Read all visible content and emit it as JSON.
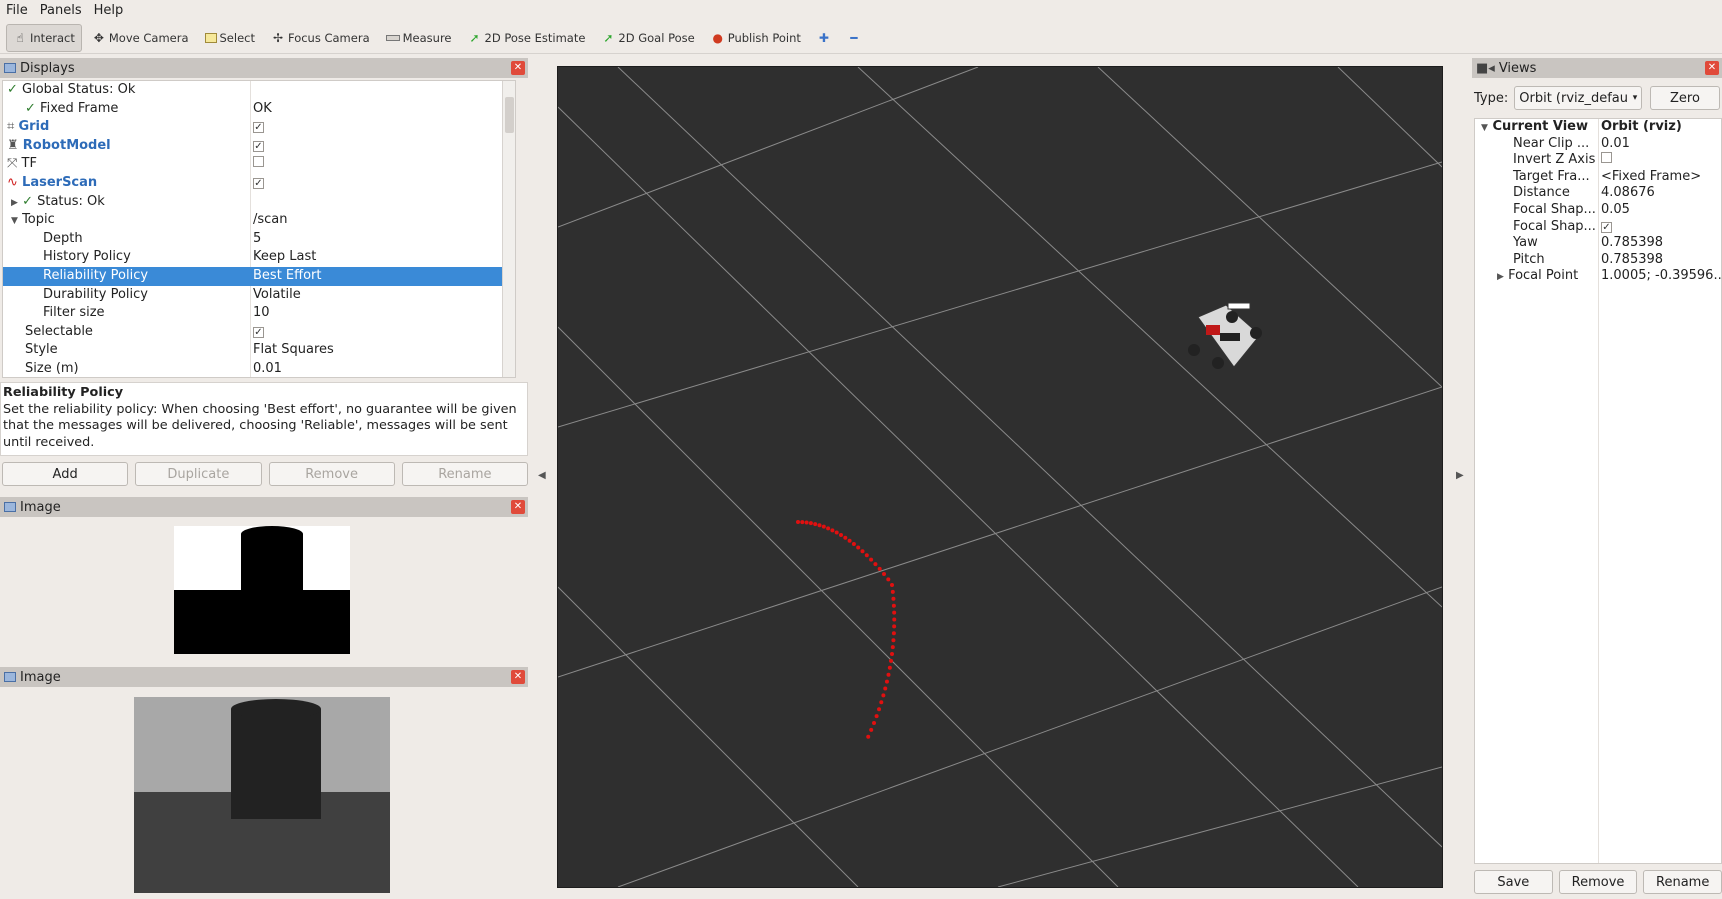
{
  "menu": [
    "File",
    "Panels",
    "Help"
  ],
  "toolbar": {
    "tools": [
      {
        "label": "Interact",
        "icon": "hand-icon"
      },
      {
        "label": "Move Camera",
        "icon": "move-icon"
      },
      {
        "label": "Select",
        "icon": "select-box-icon"
      },
      {
        "label": "Focus Camera",
        "icon": "focus-icon"
      },
      {
        "label": "Measure",
        "icon": "ruler-icon"
      },
      {
        "label": "2D Pose Estimate",
        "icon": "arrow-green-icon"
      },
      {
        "label": "2D Goal Pose",
        "icon": "arrow-green-icon"
      },
      {
        "label": "Publish Point",
        "icon": "pin-icon"
      }
    ]
  },
  "displays": {
    "title": "Displays",
    "rows": [
      {
        "key": "Global Status: Ok",
        "value": ""
      },
      {
        "key": "Fixed Frame",
        "value": "OK"
      },
      {
        "key": "Grid",
        "value": ""
      },
      {
        "key": "RobotModel",
        "value": ""
      },
      {
        "key": "TF",
        "value": ""
      },
      {
        "key": "LaserScan",
        "value": ""
      },
      {
        "key": "Status: Ok",
        "value": ""
      },
      {
        "key": "Topic",
        "value": "/scan"
      },
      {
        "key": "Depth",
        "value": "5"
      },
      {
        "key": "History Policy",
        "value": "Keep Last"
      },
      {
        "key": "Reliability Policy",
        "value": "Best Effort"
      },
      {
        "key": "Durability Policy",
        "value": "Volatile"
      },
      {
        "key": "Filter size",
        "value": "10"
      },
      {
        "key": "Selectable",
        "value": ""
      },
      {
        "key": "Style",
        "value": "Flat Squares"
      },
      {
        "key": "Size (m)",
        "value": "0.01"
      }
    ],
    "description": {
      "title": "Reliability Policy",
      "text": "Set the reliability policy: When choosing 'Best effort', no guarantee will be given that the messages will be delivered, choosing 'Reliable', messages will be sent until received."
    },
    "buttons": {
      "add": "Add",
      "duplicate": "Duplicate",
      "remove": "Remove",
      "rename": "Rename"
    }
  },
  "image_panels": [
    {
      "title": "Image"
    },
    {
      "title": "Image"
    }
  ],
  "views": {
    "title": "Views",
    "type_label": "Type:",
    "type_value": "Orbit (rviz_defau",
    "zero_label": "Zero",
    "rows": [
      {
        "key": "Current View",
        "value": "Orbit (rviz)"
      },
      {
        "key": "Near Clip ...",
        "value": "0.01"
      },
      {
        "key": "Invert Z Axis",
        "value": ""
      },
      {
        "key": "Target Fra...",
        "value": "<Fixed Frame>"
      },
      {
        "key": "Distance",
        "value": "4.08676"
      },
      {
        "key": "Focal Shap...",
        "value": "0.05"
      },
      {
        "key": "Focal Shap...",
        "value": ""
      },
      {
        "key": "Yaw",
        "value": "0.785398"
      },
      {
        "key": "Pitch",
        "value": "0.785398"
      },
      {
        "key": "Focal Point",
        "value": "1.0005; -0.39596..."
      }
    ],
    "buttons": {
      "save": "Save",
      "remove": "Remove",
      "rename": "Rename"
    }
  },
  "colors": {
    "selection": "#3a8ad7",
    "laser": "#e01010",
    "viewport_bg": "#2f2f2f",
    "grid": "#8a8a8a"
  }
}
